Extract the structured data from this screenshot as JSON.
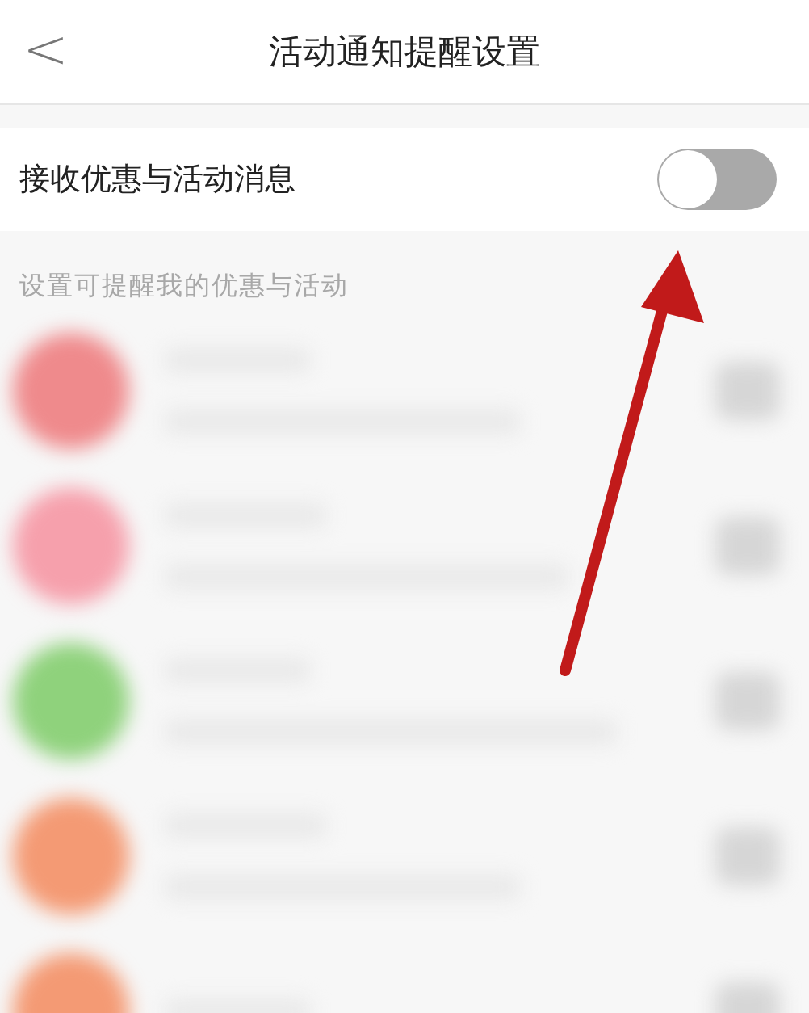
{
  "header": {
    "back": "<",
    "title": "活动通知提醒设置"
  },
  "setting": {
    "label": "接收优惠与活动消息",
    "on": false
  },
  "section": {
    "label": "设置可提醒我的优惠与活动"
  },
  "blurred_rows": [
    {
      "color": "#ef8a8c",
      "on": false
    },
    {
      "color": "#f6a0ac",
      "on": false
    },
    {
      "color": "#8fd27c",
      "on": false
    },
    {
      "color": "#f49a74",
      "on": false
    },
    {
      "color": "#f49a74",
      "on": false
    }
  ]
}
